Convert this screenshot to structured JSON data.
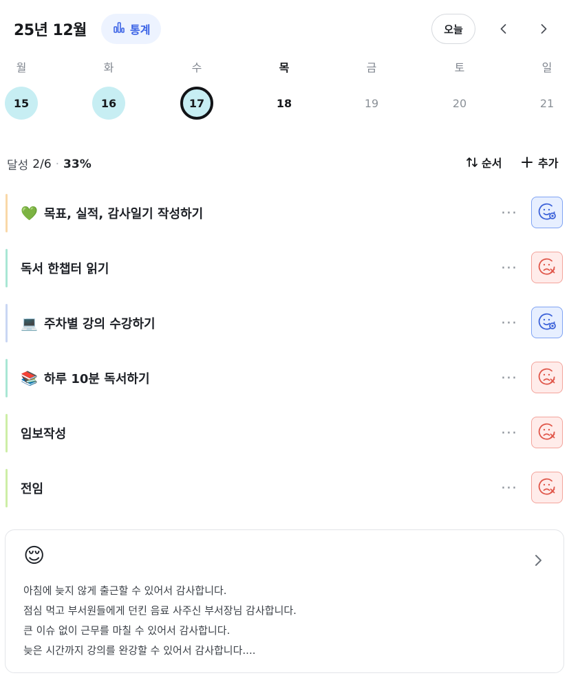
{
  "header": {
    "month_title": "25년 12월",
    "stats_label": "통계",
    "today_label": "오늘",
    "accent_color": "#3b63e6"
  },
  "week": [
    {
      "name": "월",
      "date": "15",
      "state": "filled"
    },
    {
      "name": "화",
      "date": "16",
      "state": "filled"
    },
    {
      "name": "수",
      "date": "17",
      "state": "selected"
    },
    {
      "name": "목",
      "date": "18",
      "state": "today-plain"
    },
    {
      "name": "금",
      "date": "19",
      "state": "future"
    },
    {
      "name": "토",
      "date": "20",
      "state": "future"
    },
    {
      "name": "일",
      "date": "21",
      "state": "future"
    }
  ],
  "progress": {
    "label": "달성",
    "count": "2/6",
    "separator": "·",
    "percent": "33%",
    "order_label": "순서",
    "add_label": "추가"
  },
  "tasks": [
    {
      "emoji": "💚",
      "title": "목표, 실적, 감사일기 작성하기",
      "bar_color": "#f9d8a8",
      "status": "done",
      "more": "···"
    },
    {
      "emoji": "",
      "title": "독서 한챕터 읽기",
      "bar_color": "#a9e6d4",
      "status": "fail",
      "more": "···"
    },
    {
      "emoji": "💻",
      "title": "주차별 강의 수강하기",
      "bar_color": "#c9d6f3",
      "status": "done",
      "more": "···"
    },
    {
      "emoji": "📚",
      "title": "하루 10분 독서하기",
      "bar_color": "#a9e6d4",
      "status": "fail",
      "more": "···"
    },
    {
      "emoji": "",
      "title": "임보작성",
      "bar_color": "#cdeea6",
      "status": "fail",
      "more": "···"
    },
    {
      "emoji": "",
      "title": "전임",
      "bar_color": "#cdeea6",
      "status": "fail",
      "more": "···"
    }
  ],
  "journal": {
    "emoji": "😌",
    "lines": [
      "아침에 늦지 않게 출근할 수 있어서 감사합니다.",
      "점심 먹고 부서원들에게 던킨 음료 사주신 부서장님 감사합니다.",
      "큰 이슈 없이 근무를 마칠 수 있어서 감사합니다.",
      "늦은 시간까지 강의를 완강할 수 있어서 감사합니다...."
    ]
  }
}
